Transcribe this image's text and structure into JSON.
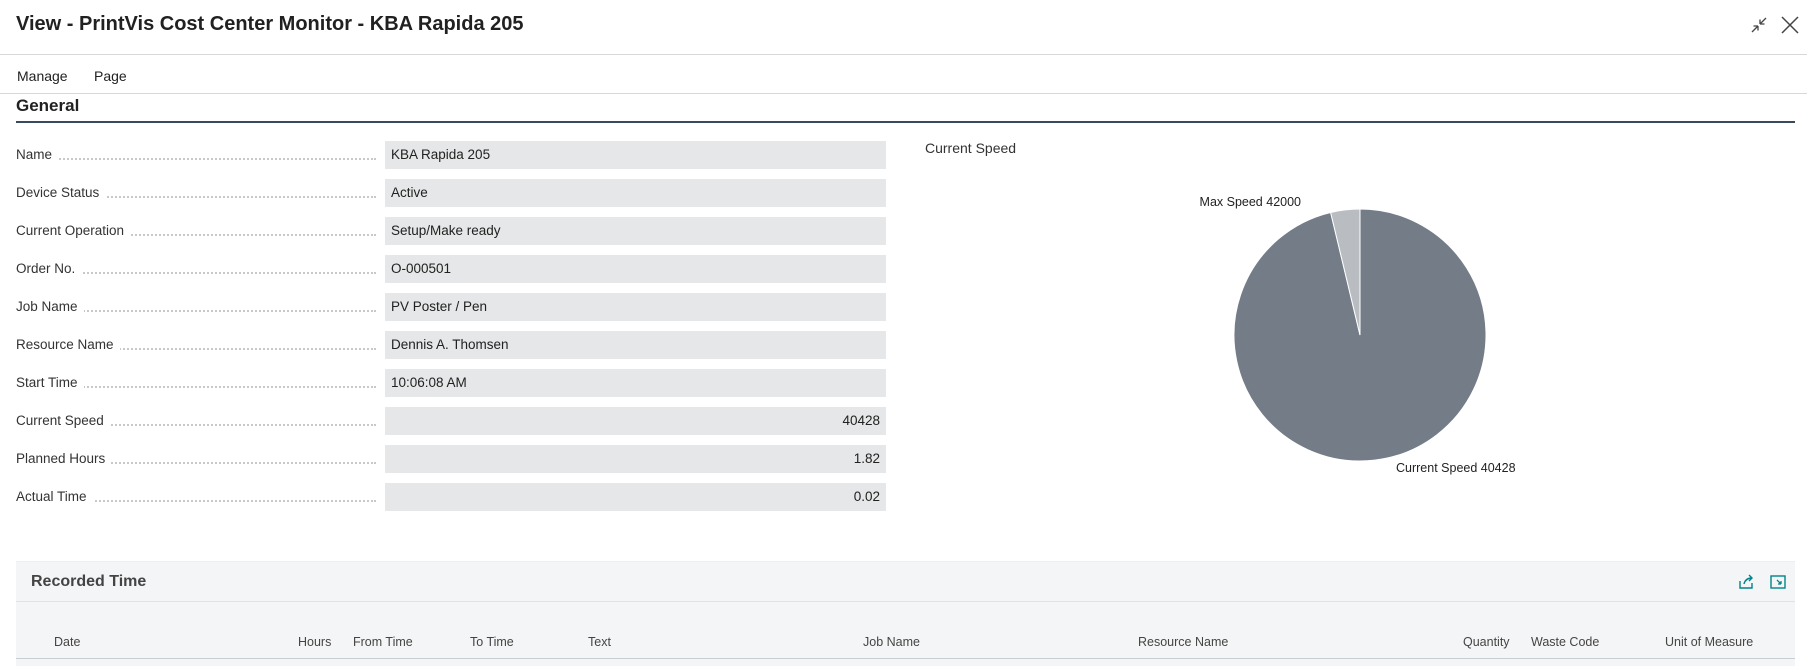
{
  "window": {
    "title": "View - PrintVis Cost Center Monitor - KBA Rapida 205"
  },
  "actions": {
    "manage": "Manage",
    "page": "Page"
  },
  "general": {
    "title": "General",
    "fields": [
      {
        "label": "Name",
        "value": "KBA Rapida 205"
      },
      {
        "label": "Device Status",
        "value": "Active"
      },
      {
        "label": "Current Operation",
        "value": "Setup/Make ready"
      },
      {
        "label": "Order No.",
        "value": "O-000501"
      },
      {
        "label": "Job Name",
        "value": "PV Poster / Pen"
      },
      {
        "label": "Resource Name",
        "value": "Dennis A. Thomsen"
      },
      {
        "label": "Start Time",
        "value": "10:06:08 AM"
      },
      {
        "label": "Current Speed",
        "value": "40428"
      },
      {
        "label": "Planned Hours",
        "value": "1.82"
      },
      {
        "label": "Actual Time",
        "value": "0.02"
      }
    ]
  },
  "chart_caption": "Current Speed",
  "chart_data": {
    "type": "pie",
    "title": "Current Speed",
    "slices": [
      {
        "label": "Current Speed 40428",
        "value": 40428,
        "color": "#737c87"
      },
      {
        "label": "Max Speed 42000",
        "value": 1572,
        "color": "#b9bdc2"
      }
    ]
  },
  "recorded_time": {
    "title": "Recorded Time",
    "columns": {
      "date": "Date",
      "hours": "Hours",
      "from_time": "From Time",
      "to_time": "To Time",
      "text": "Text",
      "job_name": "Job Name",
      "resource_name": "Resource Name",
      "quantity": "Quantity",
      "waste_code": "Waste Code",
      "unit_of_measure": "Unit of Measure"
    }
  },
  "colors": {
    "accent": "#008489",
    "section_line": "#3a4a5a",
    "field_bg": "#e6e7e8"
  },
  "icons": {
    "collapse": "collapse-icon",
    "close": "close-icon",
    "share": "share-icon",
    "expand": "expand-icon"
  }
}
